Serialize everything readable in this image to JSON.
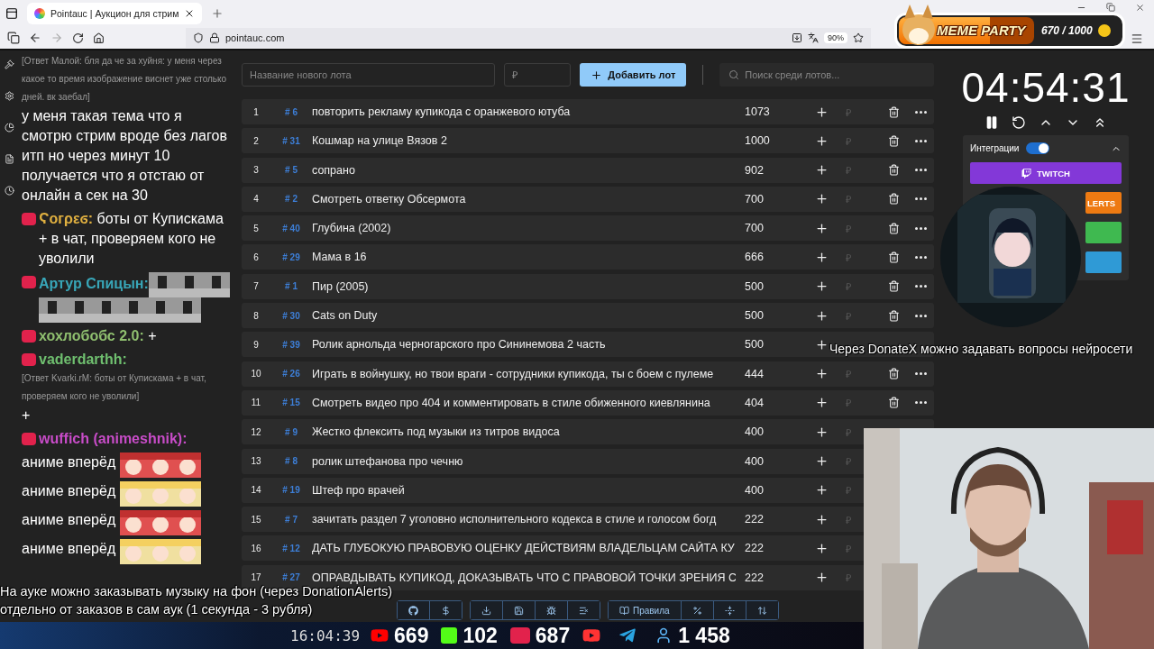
{
  "browser": {
    "tab_title": "Pointauc | Аукцион для стрим",
    "url": "pointauc.com",
    "zoom": "90%"
  },
  "meme_party": {
    "title": "MEME PARTY",
    "progress": "670 / 1000",
    "level": 0.67
  },
  "chat": [
    {
      "kind": "reply",
      "text": "[Ответ Малой: бля да че за хуйня: у меня через какое то время изображение виснет уже столько дней. вк заебал]"
    },
    {
      "kind": "text",
      "text": "у меня такая тема что я смотрю стрим вроде без лагов итп но через минут 10 получается что я отстаю от онлайн а сек на 30"
    },
    {
      "kind": "message",
      "user": "Ϛогρεϭ:",
      "color": "#e0b040",
      "text": "боты от Купискама + в чат, проверяем кого не уволили"
    },
    {
      "kind": "message",
      "user": "Артур Спицын:",
      "color": "#38a6b8"
    },
    {
      "kind": "message",
      "user": "хохлобобс 2.0:",
      "color": "#8fbf6f",
      "text": "+"
    },
    {
      "kind": "message",
      "user": "vaderdarthh:",
      "color": "#6fbf6f"
    },
    {
      "kind": "reply",
      "text": "[Ответ Kvarki.rM: боты от Купискама + в чат, проверяем кого не уволили]"
    },
    {
      "kind": "text",
      "text": "+"
    },
    {
      "kind": "message",
      "user": "wuffich (animeshnik):",
      "color": "#c84cc8"
    },
    {
      "kind": "emote_line",
      "text": "аниме вперёд"
    },
    {
      "kind": "emote_line",
      "text": "аниме вперёд"
    },
    {
      "kind": "emote_line",
      "text": "аниме вперёд"
    },
    {
      "kind": "emote_line",
      "text": "аниме вперёд"
    }
  ],
  "lot_form": {
    "name_placeholder": "Название нового лота",
    "amount_placeholder": "₽",
    "add_button": "Добавить лот",
    "search_placeholder": "Поиск среди лотов..."
  },
  "lots": [
    {
      "index": "1",
      "id": "# 6",
      "name": "повторить рекламу купикода с оранжевого ютуба",
      "amount": "1073",
      "amount_input": true,
      "actions": true
    },
    {
      "index": "2",
      "id": "# 31",
      "name": "Кошмар на улице Вязов 2",
      "amount": "1000",
      "amount_input": true,
      "actions": true
    },
    {
      "index": "3",
      "id": "# 5",
      "name": "сопрано",
      "amount": "902",
      "amount_input": true,
      "actions": true
    },
    {
      "index": "4",
      "id": "# 2",
      "name": "Смотреть ответку Обсермота",
      "amount": "700",
      "amount_input": true,
      "actions": true
    },
    {
      "index": "5",
      "id": "# 40",
      "name": "Глубина (2002)",
      "amount": "700",
      "amount_input": true,
      "actions": true
    },
    {
      "index": "6",
      "id": "# 29",
      "name": "Мама в 16",
      "amount": "666",
      "amount_input": true,
      "actions": true
    },
    {
      "index": "7",
      "id": "# 1",
      "name": "Пир (2005)",
      "amount": "500",
      "amount_input": true,
      "actions": true
    },
    {
      "index": "8",
      "id": "# 30",
      "name": "Cats on Duty",
      "amount": "500",
      "amount_input": true,
      "actions": true
    },
    {
      "index": "9",
      "id": "# 39",
      "name": "Ролик арнольда черногарского про Сининемова 2 часть",
      "amount": "500",
      "amount_input": false,
      "actions": false
    },
    {
      "index": "10",
      "id": "# 26",
      "name": "Играть в войнушку, но твои враги - сотрудники купикода, ты с боем с пулеме",
      "amount": "444",
      "amount_input": true,
      "actions": true
    },
    {
      "index": "11",
      "id": "# 15",
      "name": "Смотреть видео про 404 и комментировать в стиле обиженного киевлянина",
      "amount": "404",
      "amount_input": true,
      "actions": true
    },
    {
      "index": "12",
      "id": "# 9",
      "name": "Жестко флексить под музыки из титров видоса",
      "amount": "400",
      "amount_input": true,
      "actions": false
    },
    {
      "index": "13",
      "id": "# 8",
      "name": " ролик штефанова про чечню",
      "amount": "400",
      "amount_input": true,
      "actions": false
    },
    {
      "index": "14",
      "id": "# 19",
      "name": "Штеф про врачей",
      "amount": "400",
      "amount_input": true,
      "actions": false
    },
    {
      "index": "15",
      "id": "# 7",
      "name": "зачитать раздел 7 уголовно исполнительного кодекса в стиле и голосом богд",
      "amount": "222",
      "amount_input": true,
      "actions": false
    },
    {
      "index": "16",
      "id": "# 12",
      "name": "ДАТЬ ГЛУБОКУЮ ПРАВОВУЮ ОЦЕНКУ ДЕЙСТВИЯМ ВЛАДЕЛЬЦАМ САЙТА КУ",
      "amount": "222",
      "amount_input": true,
      "actions": false
    },
    {
      "index": "17",
      "id": "# 27",
      "name": "ОПРАВДЫВАТЬ КУПИКОД, ДОКАЗЫВАТЬ ЧТО С ПРАВОВОЙ ТОЧКИ ЗРЕНИЯ С",
      "amount": "222",
      "amount_input": true,
      "actions": false
    }
  ],
  "bottom_toolbar": {
    "rules_button": "Правила"
  },
  "timer": {
    "time": "04:54:31"
  },
  "integrations": {
    "title": "Интеграции",
    "on": true,
    "expanded": true,
    "buttons": [
      {
        "label": "TWITCH",
        "color": "#8338d8"
      },
      {
        "label": "LERTS",
        "color": "#ee7a12"
      },
      {
        "color": "#3fb950"
      },
      {
        "color": "#2f9ad6"
      }
    ]
  },
  "captions": {
    "side": "Через DonateX можно задавать вопросы нейросети",
    "bottom": [
      "На ауке можно заказывать музыку на фон (через DonationAlerts)",
      "отдельно от заказов в сам аук (1 секунда - 3 рубля)"
    ]
  },
  "stream_stats": {
    "time": "16:04:39",
    "youtube": "669",
    "kick": "102",
    "vk": "687",
    "total": "1 458"
  }
}
